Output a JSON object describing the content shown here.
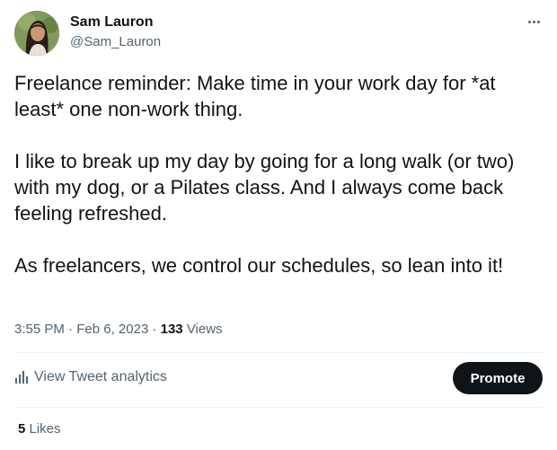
{
  "author": {
    "name": "Sam Lauron",
    "handle": "@Sam_Lauron",
    "avatar_icon": "profile-photo"
  },
  "more_icon": "ellipsis-icon",
  "tweet": {
    "paragraphs": [
      "Freelance reminder: Make time in your work day for *at least* one non-work thing.",
      "I like to break up my day by going for a long walk (or two) with my dog, or a Pilates class. And I always come back feeling refreshed.",
      "As freelancers, we control our schedules, so lean into it!"
    ]
  },
  "meta": {
    "time": "3:55 PM",
    "separator": " · ",
    "date": "Feb 6, 2023",
    "views_count": "133",
    "views_label": " Views"
  },
  "analytics": {
    "icon": "bar-chart-icon",
    "label": "View Tweet analytics"
  },
  "promote": {
    "label": "Promote"
  },
  "likes": {
    "count": "5",
    "label": " Likes"
  },
  "colors": {
    "text_primary": "#0f1419",
    "text_secondary": "#536471",
    "divider": "#eff3f4",
    "button_bg": "#0f1419",
    "button_text": "#ffffff"
  }
}
